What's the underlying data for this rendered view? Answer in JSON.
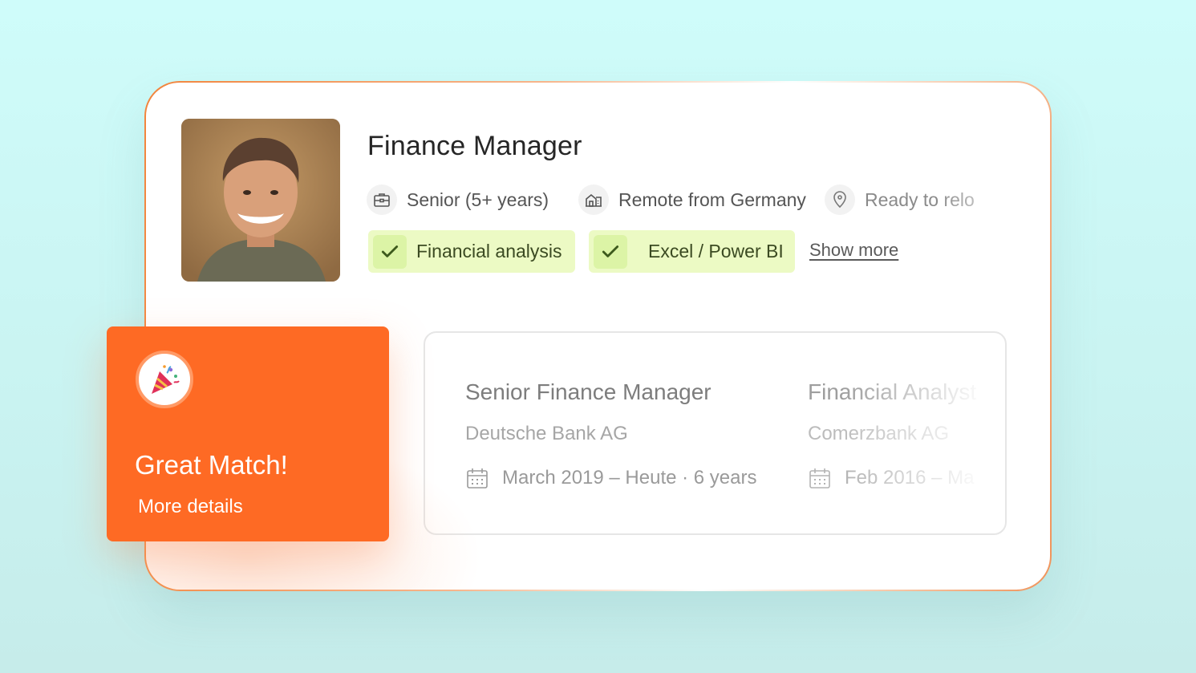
{
  "profile": {
    "title": "Finance Manager",
    "meta": [
      {
        "icon": "briefcase-icon",
        "label": "Senior (5+ years)"
      },
      {
        "icon": "building-icon",
        "label": "Remote from Germany"
      },
      {
        "icon": "location-pin-icon",
        "label": "Ready to relo"
      }
    ],
    "skills": [
      {
        "icon": "check-icon",
        "label": "Financial analysis"
      },
      {
        "icon": "check-icon",
        "label": "Excel / Power BI"
      }
    ],
    "show_more": "Show more"
  },
  "experience": [
    {
      "role": "Senior Finance Manager",
      "company": "Deutsche Bank AG",
      "dates": "March 2019 – Heute · 6 years"
    },
    {
      "role": "Financial Analyst",
      "company": "Comerzbank AG",
      "dates": "Feb 2016 – Ma"
    }
  ],
  "match": {
    "icon": "party-popper-icon",
    "title": "Great Match!",
    "link": "More details"
  },
  "colors": {
    "accent": "#fe6a24",
    "skill_bg": "#ecfac4",
    "background": "#cffcfa"
  }
}
